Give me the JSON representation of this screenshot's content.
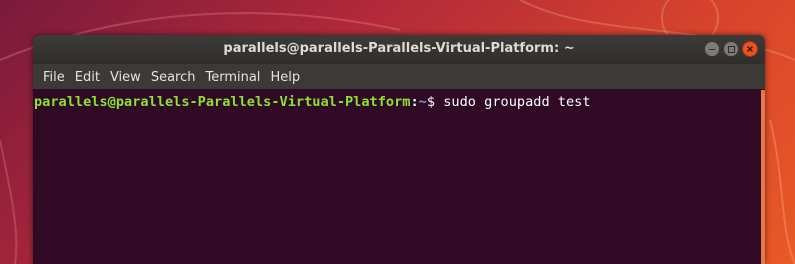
{
  "window": {
    "title": "parallels@parallels-Parallels-Virtual-Platform: ~",
    "controls": [
      {
        "name": "minimize",
        "icon": "minimize-icon"
      },
      {
        "name": "maximize",
        "icon": "maximize-icon"
      },
      {
        "name": "close",
        "icon": "close-icon"
      }
    ]
  },
  "menu": {
    "items": [
      "File",
      "Edit",
      "View",
      "Search",
      "Terminal",
      "Help"
    ]
  },
  "terminal": {
    "prompt_user": "parallels@parallels-Parallels-Virtual-Platform",
    "prompt_sep": ":",
    "prompt_path": "~",
    "prompt_sign": "$ ",
    "command": "sudo groupadd test"
  },
  "colors": {
    "terminal_bg": "#300a24",
    "prompt_user": "#8ae234",
    "prompt_path": "#729fcf",
    "close_button": "#e95420",
    "titlebar": "#3c3b37"
  }
}
